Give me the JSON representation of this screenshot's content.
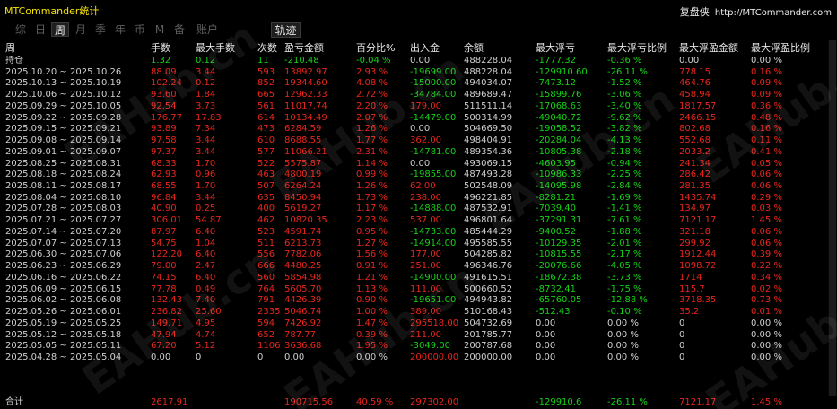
{
  "window": {
    "title": "MTCommander统计"
  },
  "brand": {
    "name": "复盘侠",
    "url": "http://MTCommander.com"
  },
  "tabs": [
    {
      "label": "综",
      "active": false
    },
    {
      "label": "日",
      "active": false
    },
    {
      "label": "周",
      "active": true
    },
    {
      "label": "月",
      "active": false
    },
    {
      "label": "季",
      "active": false
    },
    {
      "label": "年",
      "active": false
    },
    {
      "label": "币",
      "active": false
    },
    {
      "label": "M",
      "active": false
    },
    {
      "label": "备",
      "active": false
    },
    {
      "label": "账户",
      "active": false
    }
  ],
  "trace_label": "轨迹",
  "columns": {
    "period": "周",
    "lots": "手数",
    "max_lots": "最大手数",
    "count": "次数",
    "pl": "盈亏金额",
    "pct": "百分比%",
    "io": "出入金",
    "balance": "余额",
    "max_loss": "最大浮亏",
    "max_loss_pct": "最大浮亏比例",
    "max_float": "最大浮盈金额",
    "max_float_pct": "最大浮盈比例"
  },
  "rows": [
    {
      "period": "持仓",
      "lots": "1.32",
      "max_lots": "0.12",
      "count": "11",
      "pl": "-210.48",
      "pct": "-0.04 %",
      "io": "0.00",
      "balance": "488228.04",
      "max_loss": "-1777.32",
      "max_loss_pct": "-0.36 %",
      "max_float": "0.00",
      "max_float_pct": "0.00 %",
      "color": "green"
    },
    {
      "period": "2025.10.20 ~ 2025.10.26",
      "lots": "88.09",
      "max_lots": "3.44",
      "count": "593",
      "pl": "13892.97",
      "pct": "2.93 %",
      "io": "-19699.00",
      "balance": "488228.04",
      "max_loss": "-129910.60",
      "max_loss_pct": "-26.11 %",
      "max_float": "778.15",
      "max_float_pct": "0.16 %",
      "color": "red"
    },
    {
      "period": "2025.10.13 ~ 2025.10.19",
      "lots": "102.24",
      "max_lots": "0.12",
      "count": "852",
      "pl": "19344.60",
      "pct": "4.08 %",
      "io": "-15000.00",
      "balance": "494034.07",
      "max_loss": "-7473.12",
      "max_loss_pct": "-1.52 %",
      "max_float": "464.76",
      "max_float_pct": "0.09 %",
      "color": "red"
    },
    {
      "period": "2025.10.06 ~ 2025.10.12",
      "lots": "93.60",
      "max_lots": "1.84",
      "count": "665",
      "pl": "12962.33",
      "pct": "2.72 %",
      "io": "-34784.00",
      "balance": "489689.47",
      "max_loss": "-15899.76",
      "max_loss_pct": "-3.06 %",
      "max_float": "458.94",
      "max_float_pct": "0.09 %",
      "color": "red"
    },
    {
      "period": "2025.09.29 ~ 2025.10.05",
      "lots": "92.54",
      "max_lots": "3.73",
      "count": "561",
      "pl": "11017.74",
      "pct": "2.20 %",
      "io": "179.00",
      "balance": "511511.14",
      "max_loss": "-17068.63",
      "max_loss_pct": "-3.40 %",
      "max_float": "1817.57",
      "max_float_pct": "0.36 %",
      "color": "red"
    },
    {
      "period": "2025.09.22 ~ 2025.09.28",
      "lots": "176.77",
      "max_lots": "17.83",
      "count": "614",
      "pl": "10134.49",
      "pct": "2.07 %",
      "io": "-14479.00",
      "balance": "500314.99",
      "max_loss": "-49040.72",
      "max_loss_pct": "-9.62 %",
      "max_float": "2466.15",
      "max_float_pct": "0.48 %",
      "color": "red"
    },
    {
      "period": "2025.09.15 ~ 2025.09.21",
      "lots": "93.89",
      "max_lots": "7.34",
      "count": "473",
      "pl": "6284.59",
      "pct": "1.26 %",
      "io": "0.00",
      "balance": "504669.50",
      "max_loss": "-19058.52",
      "max_loss_pct": "-3.82 %",
      "max_float": "802.68",
      "max_float_pct": "0.16 %",
      "color": "red"
    },
    {
      "period": "2025.09.08 ~ 2025.09.14",
      "lots": "97.58",
      "max_lots": "3.44",
      "count": "610",
      "pl": "8688.55",
      "pct": "1.77 %",
      "io": "362.00",
      "balance": "498404.91",
      "max_loss": "-20284.04",
      "max_loss_pct": "-4.13 %",
      "max_float": "552.68",
      "max_float_pct": "0.11 %",
      "color": "red"
    },
    {
      "period": "2025.09.01 ~ 2025.09.07",
      "lots": "97.37",
      "max_lots": "3.44",
      "count": "577",
      "pl": "11066.21",
      "pct": "2.31 %",
      "io": "-14781.00",
      "balance": "489354.36",
      "max_loss": "-10805.38",
      "max_loss_pct": "-2.18 %",
      "max_float": "2033.2",
      "max_float_pct": "0.41 %",
      "color": "red"
    },
    {
      "period": "2025.08.25 ~ 2025.08.31",
      "lots": "68.33",
      "max_lots": "1.70",
      "count": "522",
      "pl": "5575.87",
      "pct": "1.14 %",
      "io": "0.00",
      "balance": "493069.15",
      "max_loss": "-4603.95",
      "max_loss_pct": "-0.94 %",
      "max_float": "241.34",
      "max_float_pct": "0.05 %",
      "color": "red"
    },
    {
      "period": "2025.08.18 ~ 2025.08.24",
      "lots": "62.93",
      "max_lots": "0.96",
      "count": "463",
      "pl": "4800.19",
      "pct": "0.99 %",
      "io": "-19855.00",
      "balance": "487493.28",
      "max_loss": "-10986.33",
      "max_loss_pct": "-2.25 %",
      "max_float": "286.42",
      "max_float_pct": "0.06 %",
      "color": "red"
    },
    {
      "period": "2025.08.11 ~ 2025.08.17",
      "lots": "68.55",
      "max_lots": "1.70",
      "count": "507",
      "pl": "6264.24",
      "pct": "1.26 %",
      "io": "62.00",
      "balance": "502548.09",
      "max_loss": "-14095.98",
      "max_loss_pct": "-2.84 %",
      "max_float": "281.35",
      "max_float_pct": "0.06 %",
      "color": "red"
    },
    {
      "period": "2025.08.04 ~ 2025.08.10",
      "lots": "96.84",
      "max_lots": "3.44",
      "count": "635",
      "pl": "8450.94",
      "pct": "1.73 %",
      "io": "238.00",
      "balance": "496221.85",
      "max_loss": "-8281.21",
      "max_loss_pct": "-1.69 %",
      "max_float": "1435.74",
      "max_float_pct": "0.29 %",
      "color": "red"
    },
    {
      "period": "2025.07.28 ~ 2025.08.03",
      "lots": "40.90",
      "max_lots": "0.25",
      "count": "400",
      "pl": "5619.27",
      "pct": "1.17 %",
      "io": "-14888.00",
      "balance": "487532.91",
      "max_loss": "-7039.40",
      "max_loss_pct": "-1.41 %",
      "max_float": "134.97",
      "max_float_pct": "0.03 %",
      "color": "red"
    },
    {
      "period": "2025.07.21 ~ 2025.07.27",
      "lots": "306.01",
      "max_lots": "54.87",
      "count": "462",
      "pl": "10820.35",
      "pct": "2.23 %",
      "io": "537.00",
      "balance": "496801.64",
      "max_loss": "-37291.31",
      "max_loss_pct": "-7.61 %",
      "max_float": "7121.17",
      "max_float_pct": "1.45 %",
      "color": "red"
    },
    {
      "period": "2025.07.14 ~ 2025.07.20",
      "lots": "87.97",
      "max_lots": "6.40",
      "count": "523",
      "pl": "4591.74",
      "pct": "0.95 %",
      "io": "-14733.00",
      "balance": "485444.29",
      "max_loss": "-9400.52",
      "max_loss_pct": "-1.88 %",
      "max_float": "321.18",
      "max_float_pct": "0.06 %",
      "color": "red"
    },
    {
      "period": "2025.07.07 ~ 2025.07.13",
      "lots": "54.75",
      "max_lots": "1.04",
      "count": "511",
      "pl": "6213.73",
      "pct": "1.27 %",
      "io": "-14914.00",
      "balance": "495585.55",
      "max_loss": "-10129.35",
      "max_loss_pct": "-2.01 %",
      "max_float": "299.92",
      "max_float_pct": "0.06 %",
      "color": "red"
    },
    {
      "period": "2025.06.30 ~ 2025.07.06",
      "lots": "122.20",
      "max_lots": "6.40",
      "count": "556",
      "pl": "7782.06",
      "pct": "1.56 %",
      "io": "177.00",
      "balance": "504285.82",
      "max_loss": "-10815.55",
      "max_loss_pct": "-2.17 %",
      "max_float": "1912.44",
      "max_float_pct": "0.39 %",
      "color": "red"
    },
    {
      "period": "2025.06.23 ~ 2025.06.29",
      "lots": "79.00",
      "max_lots": "2.47",
      "count": "666",
      "pl": "4480.25",
      "pct": "0.91 %",
      "io": "251.00",
      "balance": "496346.76",
      "max_loss": "-20076.66",
      "max_loss_pct": "-4.05 %",
      "max_float": "1098.72",
      "max_float_pct": "0.22 %",
      "color": "red"
    },
    {
      "period": "2025.06.16 ~ 2025.06.22",
      "lots": "74.15",
      "max_lots": "6.40",
      "count": "560",
      "pl": "5854.98",
      "pct": "1.21 %",
      "io": "-14900.00",
      "balance": "491615.51",
      "max_loss": "-18672.38",
      "max_loss_pct": "-3.73 %",
      "max_float": "1714",
      "max_float_pct": "0.34 %",
      "color": "red"
    },
    {
      "period": "2025.06.09 ~ 2025.06.15",
      "lots": "77.78",
      "max_lots": "0.49",
      "count": "764",
      "pl": "5605.70",
      "pct": "1.13 %",
      "io": "111.00",
      "balance": "500660.52",
      "max_loss": "-8732.41",
      "max_loss_pct": "-1.75 %",
      "max_float": "115.7",
      "max_float_pct": "0.02 %",
      "color": "red"
    },
    {
      "period": "2025.06.02 ~ 2025.06.08",
      "lots": "132.43",
      "max_lots": "7.40",
      "count": "791",
      "pl": "4426.39",
      "pct": "0.90 %",
      "io": "-19651.00",
      "balance": "494943.82",
      "max_loss": "-65760.05",
      "max_loss_pct": "-12.88 %",
      "max_float": "3718.35",
      "max_float_pct": "0.73 %",
      "color": "red"
    },
    {
      "period": "2025.05.26 ~ 2025.06.01",
      "lots": "236.82",
      "max_lots": "25.60",
      "count": "2335",
      "pl": "5046.74",
      "pct": "1.00 %",
      "io": "389.00",
      "balance": "510168.43",
      "max_loss": "-512.43",
      "max_loss_pct": "-0.10 %",
      "max_float": "35.2",
      "max_float_pct": "0.01 %",
      "color": "red"
    },
    {
      "period": "2025.05.19 ~ 2025.05.25",
      "lots": "149.71",
      "max_lots": "4.95",
      "count": "594",
      "pl": "7426.92",
      "pct": "1.47 %",
      "io": "295518.00",
      "balance": "504732.69",
      "max_loss": "0.00",
      "max_loss_pct": "0.00 %",
      "max_float": "0",
      "max_float_pct": "0.00 %",
      "color": "red"
    },
    {
      "period": "2025.05.12 ~ 2025.05.18",
      "lots": "47.94",
      "max_lots": "4.74",
      "count": "652",
      "pl": "787.77",
      "pct": "0.39 %",
      "io": "211.00",
      "balance": "201785.77",
      "max_loss": "0.00",
      "max_loss_pct": "0.00 %",
      "max_float": "0",
      "max_float_pct": "0.00 %",
      "color": "red"
    },
    {
      "period": "2025.05.05 ~ 2025.05.11",
      "lots": "67.20",
      "max_lots": "5.12",
      "count": "1106",
      "pl": "3636.68",
      "pct": "1.95 %",
      "io": "-3049.00",
      "balance": "200787.68",
      "max_loss": "0.00",
      "max_loss_pct": "0.00 %",
      "max_float": "0",
      "max_float_pct": "0.00 %",
      "color": "red"
    },
    {
      "period": "2025.04.28 ~ 2025.05.04",
      "lots": "0.00",
      "max_lots": "0",
      "count": "0",
      "pl": "0.00",
      "pct": "0.00 %",
      "io": "200000.00",
      "balance": "200000.00",
      "max_loss": "0.00",
      "max_loss_pct": "0.00 %",
      "max_float": "0",
      "max_float_pct": "0.00 %",
      "color": "white"
    }
  ],
  "total": {
    "label": "合计",
    "lots": "2617.91",
    "max_lots": "",
    "count": "",
    "pl": "190715.56",
    "pct": "40.59 %",
    "io": "297302.00",
    "balance": "",
    "max_loss": "-129910.6",
    "max_loss_pct": "-26.11 %",
    "max_float": "7121.17",
    "max_float_pct": "1.45 %"
  },
  "watermark_text": "EAHub.cn",
  "colors": {
    "profit": "#e8261c",
    "loss": "#16d216",
    "title": "#f4e300",
    "background": "#000000"
  }
}
